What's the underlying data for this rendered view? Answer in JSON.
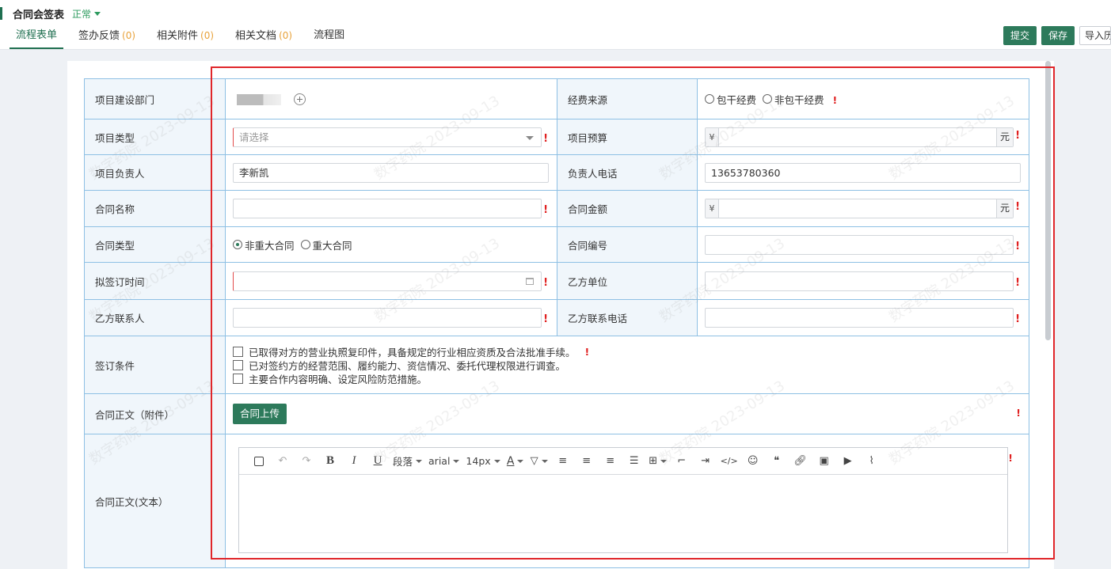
{
  "header": {
    "title": "合同会签表",
    "status": "正常",
    "tabs": [
      {
        "label": "流程表单",
        "count": ""
      },
      {
        "label": "签办反馈",
        "count": "(0)"
      },
      {
        "label": "相关附件",
        "count": "(0)"
      },
      {
        "label": "相关文档",
        "count": "(0)"
      },
      {
        "label": "流程图",
        "count": ""
      }
    ],
    "actions": {
      "submit": "提交",
      "save": "保存",
      "import": "导入历史流程"
    }
  },
  "form": {
    "dept": {
      "label": "项目建设部门"
    },
    "funding": {
      "label": "经费来源",
      "options": [
        "包干经费",
        "非包干经费"
      ]
    },
    "project_type": {
      "label": "项目类型",
      "placeholder": "请选择"
    },
    "budget": {
      "label": "项目预算",
      "prefix": "¥",
      "suffix": "元"
    },
    "owner": {
      "label": "项目负责人",
      "value": "李新凯"
    },
    "owner_phone": {
      "label": "负责人电话",
      "value": "13653780360"
    },
    "contract_name": {
      "label": "合同名称"
    },
    "contract_amount": {
      "label": "合同金额",
      "prefix": "¥",
      "suffix": "元"
    },
    "contract_type": {
      "label": "合同类型",
      "options": [
        "非重大合同",
        "重大合同"
      ]
    },
    "contract_no": {
      "label": "合同编号"
    },
    "sign_date": {
      "label": "拟签订时间"
    },
    "party_b": {
      "label": "乙方单位"
    },
    "party_b_contact": {
      "label": "乙方联系人"
    },
    "party_b_phone": {
      "label": "乙方联系电话"
    },
    "conditions": {
      "label": "签订条件",
      "items": [
        "已取得对方的营业执照复印件，具备规定的行业相应资质及合法批准手续。",
        "已对签约方的经营范围、履约能力、资信情况、委托代理权限进行调查。",
        "主要合作内容明确、设定风险防范措施。"
      ]
    },
    "attachment": {
      "label": "合同正文（附件）",
      "button": "合同上传"
    },
    "body_text": {
      "label": "合同正文(文本）"
    },
    "required_mark": "!"
  },
  "editor": {
    "paragraph": "段落",
    "font": "arial",
    "size": "14px"
  },
  "watermark": {
    "org": "数字药院",
    "date": "2023-09-13"
  }
}
